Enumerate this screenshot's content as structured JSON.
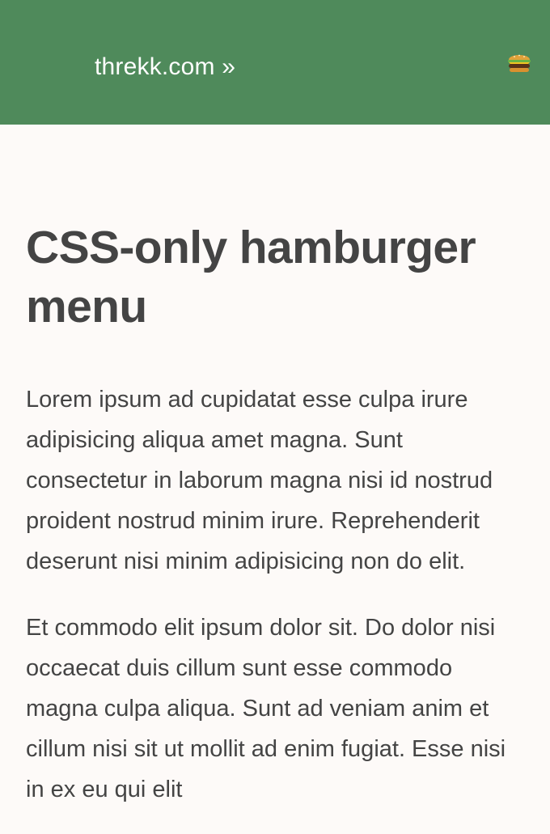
{
  "header": {
    "site_link": "threkk.com »",
    "menu_icon": "hamburger-icon",
    "background": "#4f8a5b"
  },
  "article": {
    "title": "CSS-only hamburger menu",
    "paragraphs": [
      "Lorem ipsum ad cupidatat esse culpa irure adipisicing aliqua amet magna. Sunt consectetur in laborum magna nisi id nostrud proident nostrud minim irure. Reprehenderit deserunt nisi minim adipisicing non do elit.",
      "Et commodo elit ipsum dolor sit. Do dolor nisi occaecat duis cillum sunt esse commodo magna culpa aliqua. Sunt ad veniam anim et cillum nisi sit ut mollit ad enim fugiat. Esse nisi in ex eu qui elit"
    ]
  }
}
